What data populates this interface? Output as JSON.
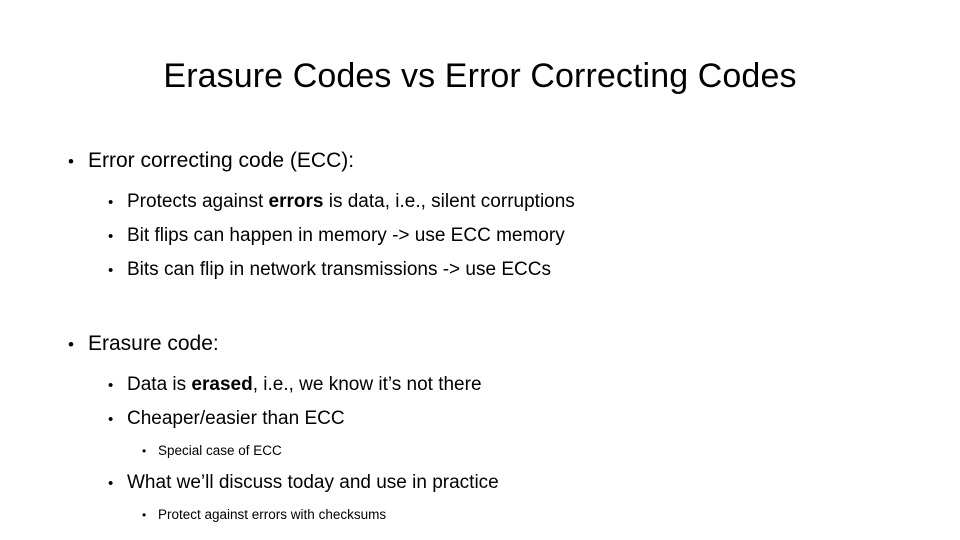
{
  "slide": {
    "title": "Erasure Codes vs Error Correcting Codes",
    "background_color": "#ffffff",
    "text_color": "#000000",
    "bullet_glyph": "•",
    "sections": [
      {
        "heading": "Error correcting code (ECC):",
        "items": [
          {
            "pre": "Protects against ",
            "bold": "errors",
            "post": " is data, i.e., silent corruptions"
          },
          {
            "pre": "Bit flips can happen in memory -> use ECC memory",
            "bold": "",
            "post": ""
          },
          {
            "pre": "Bits can flip in network transmissions -> use ECCs",
            "bold": "",
            "post": ""
          }
        ]
      },
      {
        "heading": "Erasure code:",
        "items": [
          {
            "pre": "Data is ",
            "bold": "erased",
            "post": ", i.e., we know it’s not there"
          },
          {
            "pre": "Cheaper/easier than ECC",
            "bold": "",
            "post": ""
          }
        ],
        "sub_after_item_2": "Special case of ECC",
        "item_3": "What we’ll discuss today and use in practice",
        "sub_after_item_3": "Protect against errors with checksums"
      }
    ]
  }
}
